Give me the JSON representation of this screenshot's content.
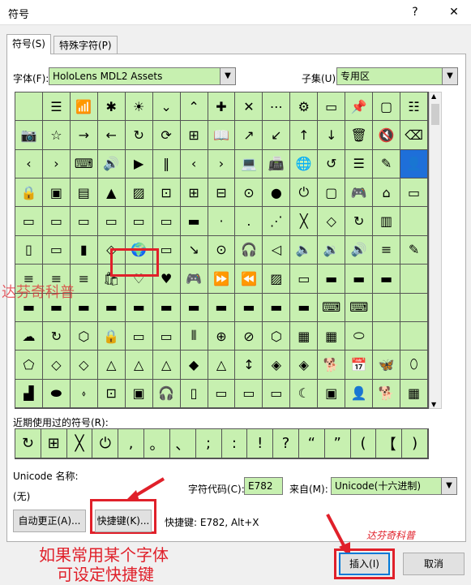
{
  "window": {
    "title": "符号",
    "help": "?",
    "close": "✕"
  },
  "tabs": [
    {
      "label": "符号(S)"
    },
    {
      "label": "特殊字符(P)"
    }
  ],
  "font": {
    "label": "字体(F):",
    "value": "HoloLens MDL2 Assets"
  },
  "subset": {
    "label": "子集(U):",
    "value": "专用区"
  },
  "grid_rows": [
    [
      "",
      "☰",
      "📶",
      "✱",
      "☀",
      "⌄",
      "⌃",
      "✚",
      "✕",
      "⋯",
      "⚙",
      "▭",
      "📌",
      "▢",
      "☷",
      "🔍",
      "🎤"
    ],
    [
      "📷",
      "☆",
      "→",
      "←",
      "↻",
      "⟳",
      "⊞",
      "📖",
      "↗",
      "↙",
      "↑",
      "↓",
      "🗑",
      "🔇",
      "⌫",
      "↵",
      "↑"
    ],
    [
      "‹",
      "›",
      "⌨",
      "🔊",
      "▶",
      "‖",
      "‹",
      "›",
      "💻",
      "📠",
      "🌐",
      "↺",
      "☰",
      "✎",
      "👤",
      "⊞",
      "!"
    ],
    [
      "🔒",
      "▣",
      "▤",
      "▲",
      "▨",
      "⊡",
      "⊞",
      "⊟",
      "⊙",
      "●",
      "⏻",
      "▢",
      "🎮",
      "⌂",
      "▭",
      "▬"
    ],
    [
      "▭",
      "▭",
      "▭",
      "▭",
      "▭",
      "▭",
      "▬",
      "·",
      ".",
      "⋰",
      "╳",
      "◇",
      "↻",
      "▥"
    ],
    [
      "▯",
      "▭",
      "▮",
      "◇",
      "🌍",
      "▭",
      "↘",
      "⊙",
      "🎧",
      "◁",
      "🔈",
      "🔉",
      "🔊",
      "≡",
      "✎"
    ],
    [
      "≡",
      "≡",
      "≡",
      "🛍",
      "♡",
      "♥",
      "🎮",
      "⏩",
      "⏪",
      "▨",
      "▭",
      "▬",
      "▬",
      "▬"
    ],
    [
      "▬",
      "▬",
      "▬",
      "▬",
      "▬",
      "▬",
      "▬",
      "▬",
      "▬",
      "▬",
      "▬",
      "⌨",
      "⌨"
    ],
    [
      "☁",
      "↻",
      "⬡",
      "🔒",
      "▭",
      "▭",
      "⫴",
      "⊕",
      "⊘",
      "⬡",
      "▦",
      "▦",
      "⬭"
    ],
    [
      "⬠",
      "◇",
      "◇",
      "△",
      "△",
      "△",
      "◆",
      "△",
      "↕",
      "◈",
      "◈",
      "🐕",
      "📅",
      "🦋",
      "⬯"
    ],
    [
      "▟",
      "⬬",
      "⬫",
      "⊡",
      "▣",
      "🎧",
      "▯",
      "▭",
      "▭",
      "▭",
      "☾",
      "▣",
      "👤",
      "🐕",
      "▦",
      "👁"
    ],
    [
      "◢",
      "▭",
      "▭",
      "▭",
      "▭",
      "▭",
      "▭",
      "▭",
      "▭",
      "▭",
      "▭",
      "▭",
      "▭",
      "▭",
      "▭"
    ]
  ],
  "recent": {
    "label": "近期使用过的符号(R):",
    "symbols": [
      "↻",
      "⊞",
      "╳",
      "⏻",
      ",",
      "。",
      "、",
      ";",
      ":",
      "!",
      "?",
      "“",
      "”",
      "(",
      "【",
      ")",
      "%"
    ]
  },
  "unicode": {
    "name_label": "Unicode 名称:",
    "name_value": "(无)"
  },
  "charcode": {
    "label": "字符代码(C):",
    "value": "E782"
  },
  "from": {
    "label": "来自(M):",
    "value": "Unicode(十六进制)"
  },
  "buttons": {
    "autocorrect": "自动更正(A)...",
    "shortcut": "快捷键(K)...",
    "insert": "插入(I)",
    "cancel": "取消"
  },
  "shortcut_info": "快捷键: E782, Alt+X",
  "annotations": {
    "watermark": "达芬奇科普",
    "note_line1": "如果常用某个字体",
    "note_line2": "可设定快捷键",
    "signature": "达芬奇科普"
  },
  "colors": {
    "grid_bg": "#c7f0b0",
    "annotation_red": "#e0202a",
    "selection": "#1e6fd9"
  }
}
